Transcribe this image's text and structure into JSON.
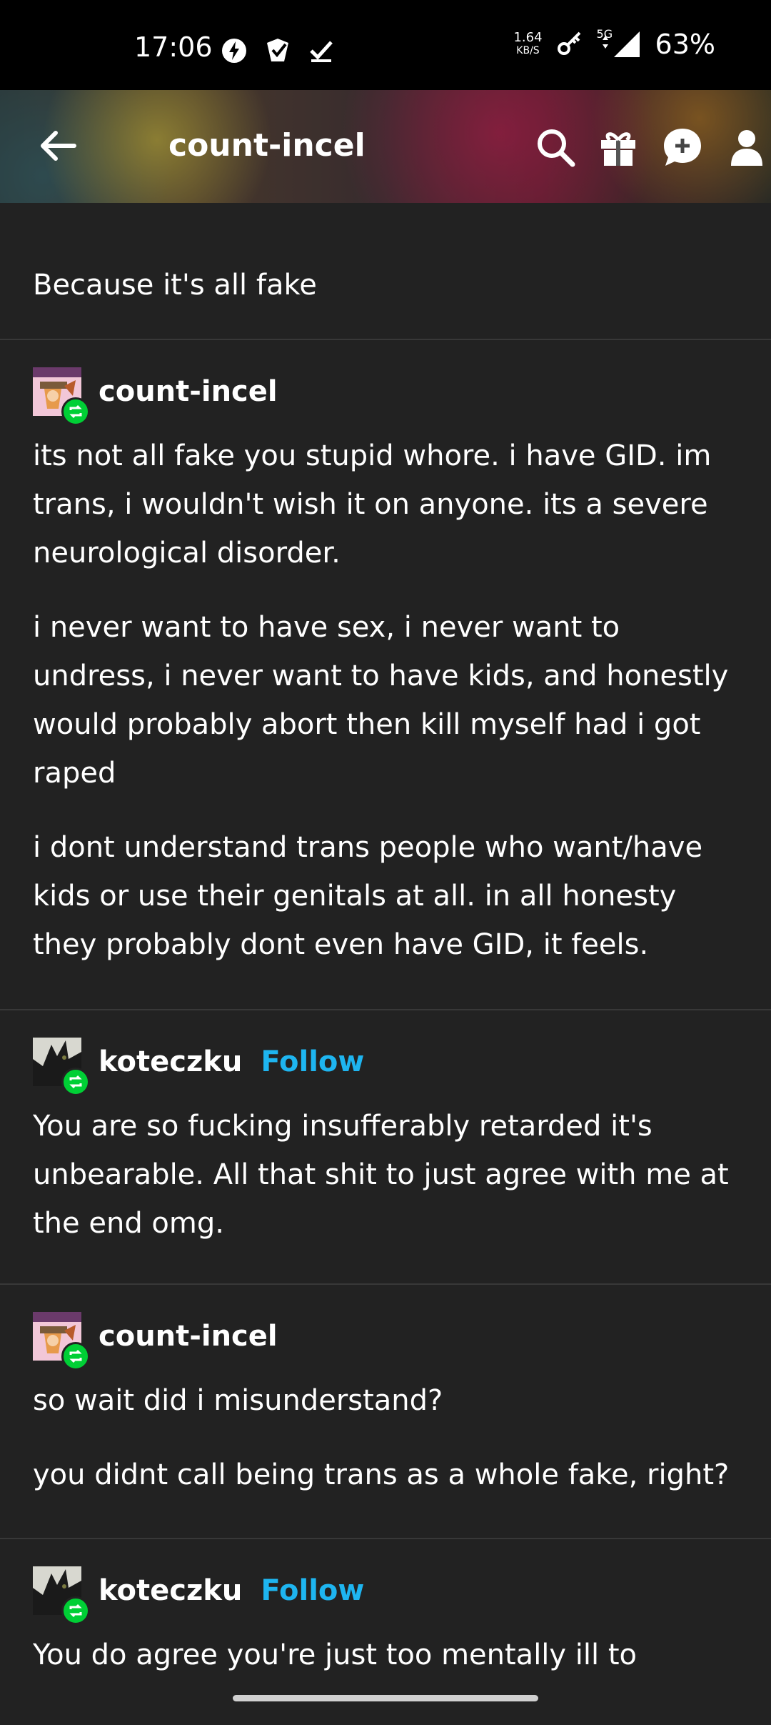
{
  "status_bar": {
    "time": "17:06",
    "net_speed_value": "1.64",
    "net_speed_unit": "KB/S",
    "network_type": "5G",
    "battery": "63%"
  },
  "header": {
    "title": "count-incel",
    "icons": [
      "back-arrow-icon",
      "search-icon",
      "gift-icon",
      "new-post-icon",
      "account-icon"
    ]
  },
  "caption": "Because it's all fake",
  "posts": [
    {
      "username": "count-incel",
      "paragraphs": [
        "its not all fake you stupid whore. i have GID. im trans, i wouldn't wish it on anyone. its a severe neurological disorder.",
        "i never want to have sex, i never want to undress, i never want to have kids, and honestly would probably abort then kill myself had i got raped",
        "i dont understand trans people who want/have kids or use their genitals at all. in all honesty they probably dont even have GID, it feels."
      ]
    },
    {
      "username": "koteczku",
      "follow_label": "Follow",
      "paragraphs": [
        "You are so fucking insufferably retarded it's unbearable. All that shit to just agree with me at the end omg."
      ]
    },
    {
      "username": "count-incel",
      "paragraphs": [
        "so wait did i misunderstand?",
        "you didnt call being trans as a whole fake, right?"
      ]
    },
    {
      "username": "koteczku",
      "follow_label": "Follow",
      "paragraphs": [
        "You do agree you're just too mentally ill to"
      ]
    }
  ],
  "colors": {
    "background": "#222222",
    "follow": "#1eb5f0",
    "reblog_badge": "#00cf35"
  }
}
